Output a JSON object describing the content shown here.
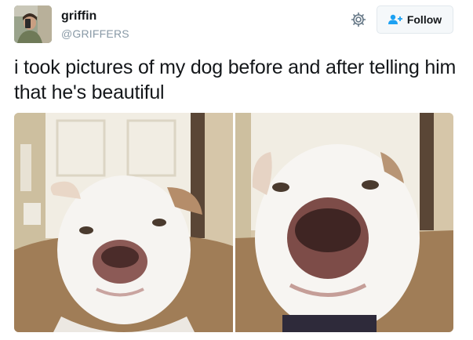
{
  "user": {
    "display_name": "griffin",
    "handle": "@GRIFFERS",
    "avatar_icon": "selfie-avatar"
  },
  "actions": {
    "settings_icon": "gear-icon",
    "follow_label": "Follow",
    "follow_icon": "add-user-icon"
  },
  "tweet": {
    "text": "i took pictures of my dog before and after telling him that he's beautiful"
  },
  "media": {
    "left_photo": "dog-photo-before",
    "right_photo": "dog-photo-after"
  },
  "colors": {
    "text": "#14171a",
    "secondary_text": "#8899a6",
    "button_bg": "#f5f8fa",
    "button_border": "#e1e8ed",
    "follow_icon": "#1da1f2"
  }
}
